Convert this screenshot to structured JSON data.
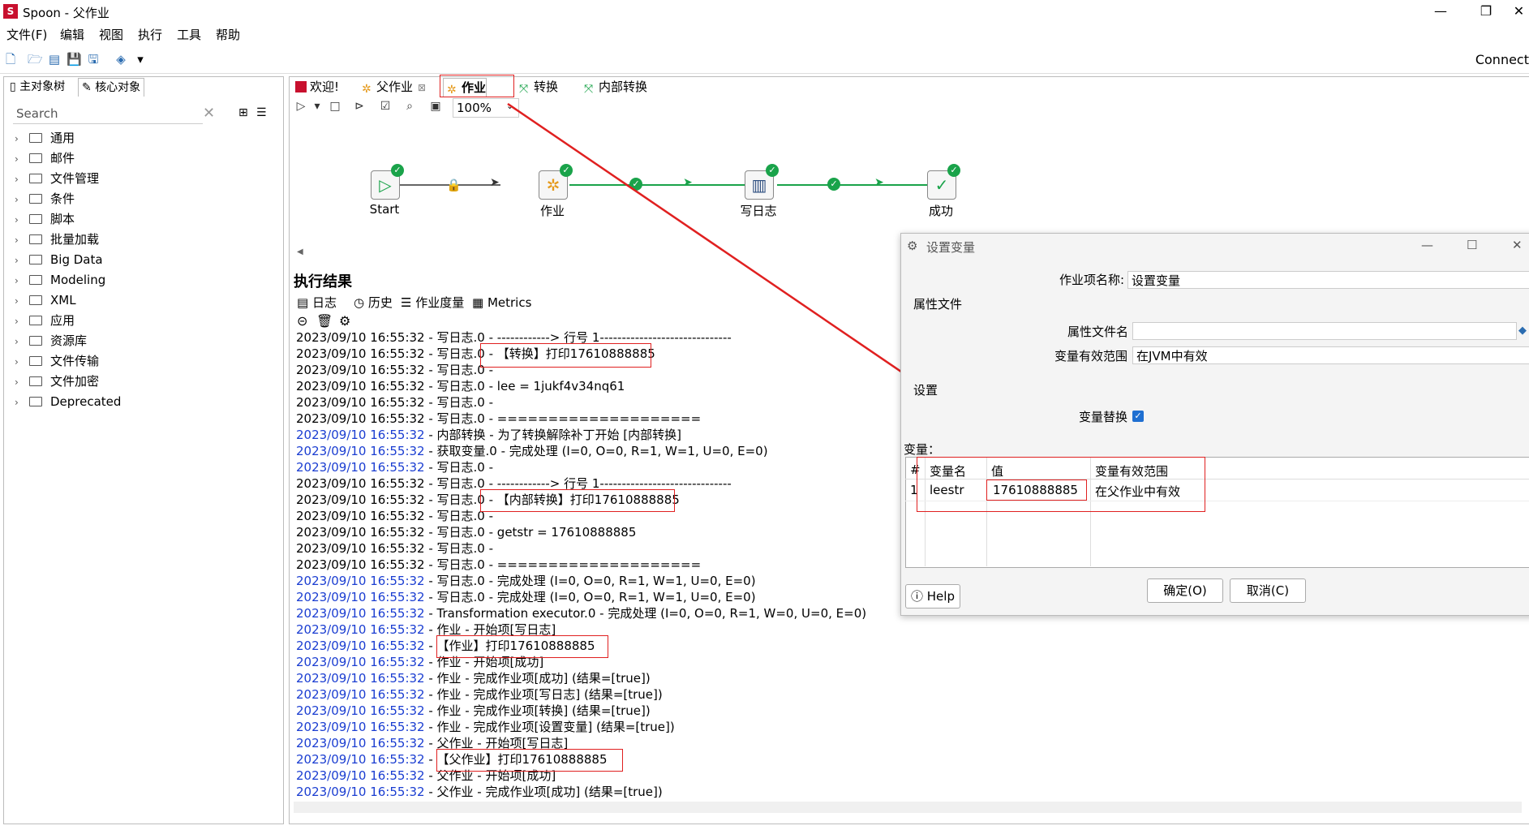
{
  "window": {
    "title": "Spoon - 父作业",
    "minimize": "—",
    "restore": "❐",
    "close": "✕",
    "connect": "Connect"
  },
  "menu": [
    "文件(F)",
    "编辑",
    "视图",
    "执行",
    "工具",
    "帮助"
  ],
  "left": {
    "tabs": [
      "主对象树",
      "核心对象"
    ],
    "search_placeholder": "Search",
    "tree": [
      "通用",
      "邮件",
      "文件管理",
      "条件",
      "脚本",
      "批量加载",
      "Big Data",
      "Modeling",
      "XML",
      "应用",
      "资源库",
      "文件传输",
      "文件加密",
      "Deprecated"
    ]
  },
  "tabs": [
    "欢迎!",
    "父作业",
    "作业",
    "转换",
    "内部转换"
  ],
  "zoom": "100%",
  "workflow": {
    "nodes": [
      "Start",
      "作业",
      "写日志",
      "成功"
    ]
  },
  "results": {
    "title": "执行结果",
    "tabs": [
      "日志",
      "历史",
      "作业度量",
      "Metrics"
    ],
    "lines": [
      {
        "ts": "2023/09/10 16:55:32",
        "text": " - 写日志.0 - ------------> 行号 1------------------------------",
        "blue": false
      },
      {
        "ts": "2023/09/10 16:55:32",
        "text": " - 写日志.0 - 【转换】打印17610888885",
        "blue": false
      },
      {
        "ts": "2023/09/10 16:55:32",
        "text": " - 写日志.0 -",
        "blue": false
      },
      {
        "ts": "2023/09/10 16:55:32",
        "text": " - 写日志.0 - lee = 1jukf4v34nq61",
        "blue": false
      },
      {
        "ts": "2023/09/10 16:55:32",
        "text": " - 写日志.0 -",
        "blue": false
      },
      {
        "ts": "2023/09/10 16:55:32",
        "text": " - 写日志.0 - ====================",
        "blue": false
      },
      {
        "ts": "2023/09/10 16:55:32",
        "text": " - 内部转换 - 为了转换解除补丁开始  [内部转换]",
        "blue": true
      },
      {
        "ts": "2023/09/10 16:55:32",
        "text": " - 获取变量.0 - 完成处理 (I=0, O=0, R=1, W=1, U=0, E=0)",
        "blue": true
      },
      {
        "ts": "2023/09/10 16:55:32",
        "text": " - 写日志.0 -",
        "blue": true
      },
      {
        "ts": "2023/09/10 16:55:32",
        "text": " - 写日志.0 - ------------> 行号 1------------------------------",
        "blue": false
      },
      {
        "ts": "2023/09/10 16:55:32",
        "text": " - 写日志.0 - 【内部转换】打印17610888885",
        "blue": false
      },
      {
        "ts": "2023/09/10 16:55:32",
        "text": " - 写日志.0 -",
        "blue": false
      },
      {
        "ts": "2023/09/10 16:55:32",
        "text": " - 写日志.0 - getstr = 17610888885",
        "blue": false
      },
      {
        "ts": "2023/09/10 16:55:32",
        "text": " - 写日志.0 -",
        "blue": false
      },
      {
        "ts": "2023/09/10 16:55:32",
        "text": " - 写日志.0 - ====================",
        "blue": false
      },
      {
        "ts": "2023/09/10 16:55:32",
        "text": " - 写日志.0 - 完成处理 (I=0, O=0, R=1, W=1, U=0, E=0)",
        "blue": true
      },
      {
        "ts": "2023/09/10 16:55:32",
        "text": " - 写日志.0 - 完成处理 (I=0, O=0, R=1, W=1, U=0, E=0)",
        "blue": true
      },
      {
        "ts": "2023/09/10 16:55:32",
        "text": " - Transformation executor.0 - 完成处理 (I=0, O=0, R=1, W=0, U=0, E=0)",
        "blue": true
      },
      {
        "ts": "2023/09/10 16:55:32",
        "text": " - 作业 - 开始项[写日志]",
        "blue": true
      },
      {
        "ts": "2023/09/10 16:55:32",
        "text": " - 【作业】打印17610888885",
        "blue": true
      },
      {
        "ts": "2023/09/10 16:55:32",
        "text": " - 作业 - 开始项[成功]",
        "blue": true
      },
      {
        "ts": "2023/09/10 16:55:32",
        "text": " - 作业 - 完成作业项[成功] (结果=[true])",
        "blue": true
      },
      {
        "ts": "2023/09/10 16:55:32",
        "text": " - 作业 - 完成作业项[写日志] (结果=[true])",
        "blue": true
      },
      {
        "ts": "2023/09/10 16:55:32",
        "text": " - 作业 - 完成作业项[转换] (结果=[true])",
        "blue": true
      },
      {
        "ts": "2023/09/10 16:55:32",
        "text": " - 作业 - 完成作业项[设置变量] (结果=[true])",
        "blue": true
      },
      {
        "ts": "2023/09/10 16:55:32",
        "text": " - 父作业 - 开始项[写日志]",
        "blue": true
      },
      {
        "ts": "2023/09/10 16:55:32",
        "text": " - 【父作业】打印17610888885",
        "blue": true
      },
      {
        "ts": "2023/09/10 16:55:32",
        "text": " - 父作业 - 开始项[成功]",
        "blue": true
      },
      {
        "ts": "2023/09/10 16:55:32",
        "text": " - 父作业 - 完成作业项[成功] (结果=[true])",
        "blue": true
      }
    ]
  },
  "dialog": {
    "title": "设置变量",
    "name_label": "作业项名称:",
    "name_value": "设置变量",
    "group_props": "属性文件",
    "propfile_label": "属性文件名",
    "propfile_value": "",
    "scope_label": "变量有效范围",
    "scope_value": "在JVM中有效",
    "group_settings": "设置",
    "replace_label": "变量替换",
    "vars_label": "变量：",
    "headers": [
      "#",
      "变量名",
      "值",
      "变量有效范围"
    ],
    "rows": [
      {
        "num": "1",
        "name": "leestr",
        "value": "17610888885",
        "scope": "在父作业中有效"
      }
    ],
    "help": "Help",
    "ok": "确定(O)",
    "cancel": "取消(C)"
  }
}
